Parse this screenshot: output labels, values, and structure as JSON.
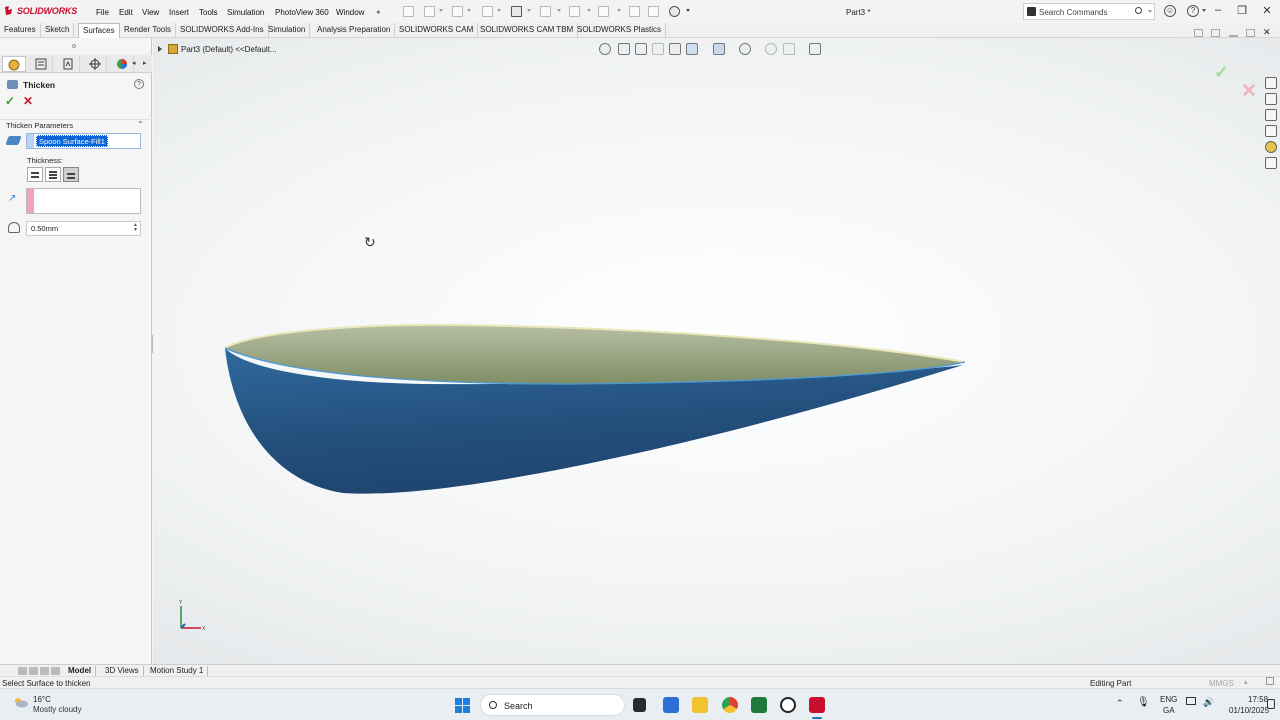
{
  "app": {
    "name": "SOLIDWORKS",
    "doc_title": "Part3 *"
  },
  "menus": [
    "File",
    "Edit",
    "View",
    "Insert",
    "Tools",
    "Simulation",
    "PhotoView 360",
    "Window"
  ],
  "search_commands": {
    "placeholder": "Search Commands"
  },
  "tabs": [
    "Features",
    "Sketch",
    "Surfaces",
    "Render Tools",
    "SOLIDWORKS Add-Ins",
    "Simulation",
    "Analysis Preparation",
    "SOLIDWORKS CAM",
    "SOLIDWORKS CAM TBM",
    "SOLIDWORKS Plastics"
  ],
  "active_tab": "Surfaces",
  "property_manager": {
    "title": "Thicken",
    "group_title": "Thicken Parameters",
    "selected_surface": "Spoon Surface-Fill1",
    "thickness_label": "Thickness:",
    "thickness_value": "0.50mm",
    "thickness_side_selected": "side-2"
  },
  "tree": {
    "node": "Part3 (Default) <<Default..."
  },
  "bottom_tabs": [
    "Model",
    "3D Views",
    "Motion Study 1"
  ],
  "status": {
    "message": "Select Surface to thicken",
    "mode": "Editing Part",
    "units": "MMGS"
  },
  "taskbar": {
    "temp": "16°C",
    "weather": "Mostly cloudy",
    "search_label": "Search",
    "lang_1": "ENG",
    "lang_2": "GA",
    "time": "17:58",
    "date": "01/10/2025"
  },
  "colors": {
    "accent": "#0a64d8",
    "model_outer": "#285887",
    "model_inner": "#8f9e78",
    "ok": "#3a9b2a",
    "cancel": "#c2182b"
  }
}
